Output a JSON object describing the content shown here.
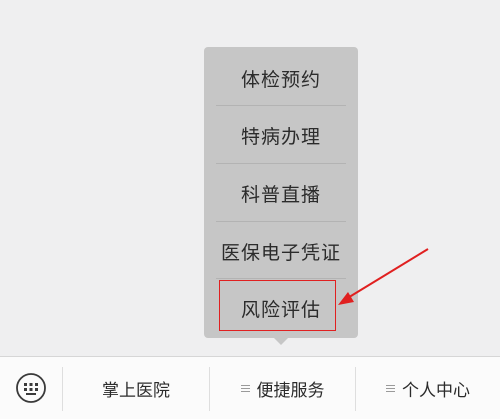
{
  "popup_menu": {
    "items": [
      {
        "label": "体检预约"
      },
      {
        "label": "特病办理"
      },
      {
        "label": "科普直播"
      },
      {
        "label": "医保电子凭证"
      },
      {
        "label": "风险评估"
      }
    ],
    "highlighted_index": 4
  },
  "bottom_bar": {
    "keyboard_icon": "keyboard-icon",
    "tabs": [
      {
        "label": "掌上医院",
        "has_menu_icon": false
      },
      {
        "label": "便捷服务",
        "has_menu_icon": true
      },
      {
        "label": "个人中心",
        "has_menu_icon": true
      }
    ]
  },
  "colors": {
    "annotation": "#e02020",
    "popup_bg": "#c6c6c6",
    "page_bg": "#efeff0"
  }
}
